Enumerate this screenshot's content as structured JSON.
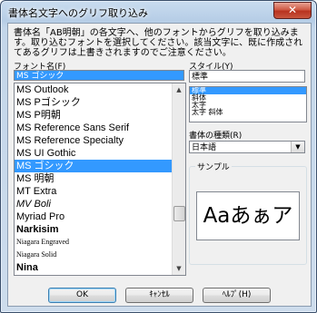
{
  "window": {
    "title": "書体名文字へのグリフ取り込み",
    "close_label": "✕"
  },
  "description": "書体名「AB明朝」の各文字へ、他のフォントからグリフを取り込みます。取り込むフォントを選択してください。該当文字に、既に作成されてあるグリフは上書きされますのでご注意ください。",
  "font_name": {
    "label": "フォント名(F)",
    "value": "MS ゴシック",
    "items": [
      "MS Outlook",
      "MS Pゴシック",
      "MS P明朝",
      "MS Reference Sans Serif",
      "MS Reference Specialty",
      "MS UI Gothic",
      "MS ゴシック",
      "MS 明朝",
      "MT Extra",
      "MV Boli",
      "Myriad Pro",
      "Narkisim",
      "Niagara Engraved",
      "Niagara Solid",
      "Nina"
    ],
    "selected_index": 6
  },
  "style": {
    "label": "スタイル(Y)",
    "value": "標準",
    "items": [
      "標準",
      "斜体",
      "太字",
      "太字 斜体"
    ],
    "selected_index": 0
  },
  "charset": {
    "label": "書体の種類(R)",
    "value": "日本語"
  },
  "sample": {
    "label": "サンプル",
    "text": "Aaあぁア"
  },
  "buttons": {
    "ok": "OK",
    "cancel": "ｷｬﾝｾﾙ",
    "help": "ﾍﾙﾌﾟ(H)"
  },
  "icons": {
    "scroll_up": "scroll-up-arrow-icon",
    "scroll_down": "scroll-down-arrow-icon",
    "dropdown": "dropdown-arrow-icon"
  },
  "colors": {
    "selection": "#3399ff",
    "close_button": "#c8553e"
  }
}
